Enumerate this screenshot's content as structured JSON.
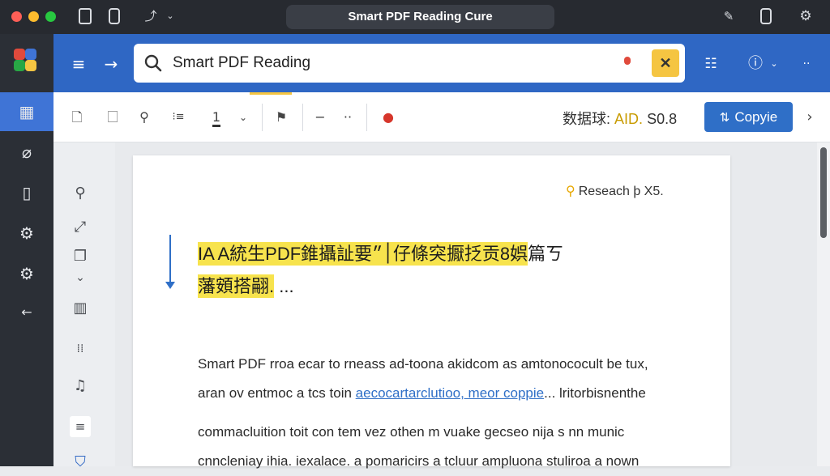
{
  "window": {
    "title": "Smart PDF Reading Cure"
  },
  "titlebar": {
    "icons": [
      "document-icon",
      "phone-icon",
      "magic-wand-icon",
      "chevron-down-icon",
      "pin-icon",
      "tablet-icon",
      "settings-gear-icon"
    ]
  },
  "appbar": {
    "items": [
      "grid-icon",
      "attachment-icon",
      "document-sidebar-icon",
      "settings-icon",
      "settings-alt-icon",
      "back-arrow-icon"
    ],
    "logo_colors": [
      "#e04a3c",
      "#3f74d6",
      "#28a745",
      "#f5c542"
    ]
  },
  "header": {
    "search": {
      "value": "Smart PDF Reading",
      "clear_label": "✕"
    }
  },
  "toolbar": {
    "coords_label": "数据球:",
    "coords_tag": "AID.",
    "coords_value": "S0.8",
    "copy_label": "Copyie"
  },
  "document": {
    "research_label": "Reseach ϸ X5.",
    "heading_line1": "IA A統生PDF錐攝訨要׀״仔條突擫抸贡8娯",
    "heading_line1_tail": "篇ㄎ",
    "heading_line2": "藩頞搭翤.",
    "heading_line2_tail": "...",
    "p1_line1": "Smart PDF rroa ecar to rneass ad-toona akidcom as amtonococult be tux,",
    "p1_line2_pre": "aran ov entmoc a tcs toin ",
    "p1_line2_link": "aecocartarclutioo, meor coppie",
    "p1_line2_post": "... lritorbisnenthe",
    "p2_line1": "commacluition toit con tem vez othen m vuake gecseo nija s nn munic",
    "p2_line2": "cnncleniay ihia. iexalace. a pomaricirs a tcluur ampluona stuliroa a nown"
  },
  "colors": {
    "accent": "#2f67c4",
    "highlight": "#f7e34d",
    "sidebar": "#2b2f36"
  }
}
